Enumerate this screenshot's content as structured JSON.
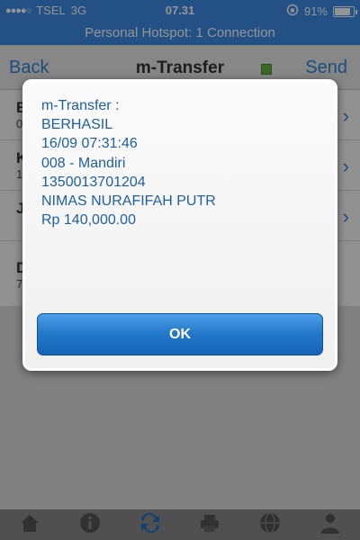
{
  "status_bar": {
    "carrier": "TSEL",
    "network": "3G",
    "time": "07.31",
    "battery": "91%",
    "battery_level": 0.91
  },
  "hotspot": {
    "text": "Personal Hotspot: 1 Connection"
  },
  "nav": {
    "back_label": "Back",
    "title": "m-Transfer",
    "send_label": "Send"
  },
  "list": {
    "items": [
      {
        "title": "B",
        "subtitle": "0"
      },
      {
        "title": "K",
        "subtitle": "1"
      },
      {
        "title": "J",
        "subtitle": ""
      },
      {
        "title": "D",
        "subtitle": "7"
      }
    ]
  },
  "dialog": {
    "lines": [
      "m-Transfer :",
      "BERHASIL",
      "16/09 07:31:46",
      "008 - Mandiri",
      "1350013701204",
      "NIMAS NURAFIFAH PUTR",
      "Rp 140,000.00"
    ],
    "ok_label": "OK"
  },
  "tabbar": {
    "icons": [
      "home-icon",
      "info-icon",
      "transfer-icon",
      "printer-icon",
      "globe-icon",
      "person-icon"
    ]
  },
  "colors": {
    "accent": "#3d8ce6",
    "link": "#2f87d8",
    "dialog_text": "#1f5f9a",
    "ok_button": "#2277c8"
  }
}
